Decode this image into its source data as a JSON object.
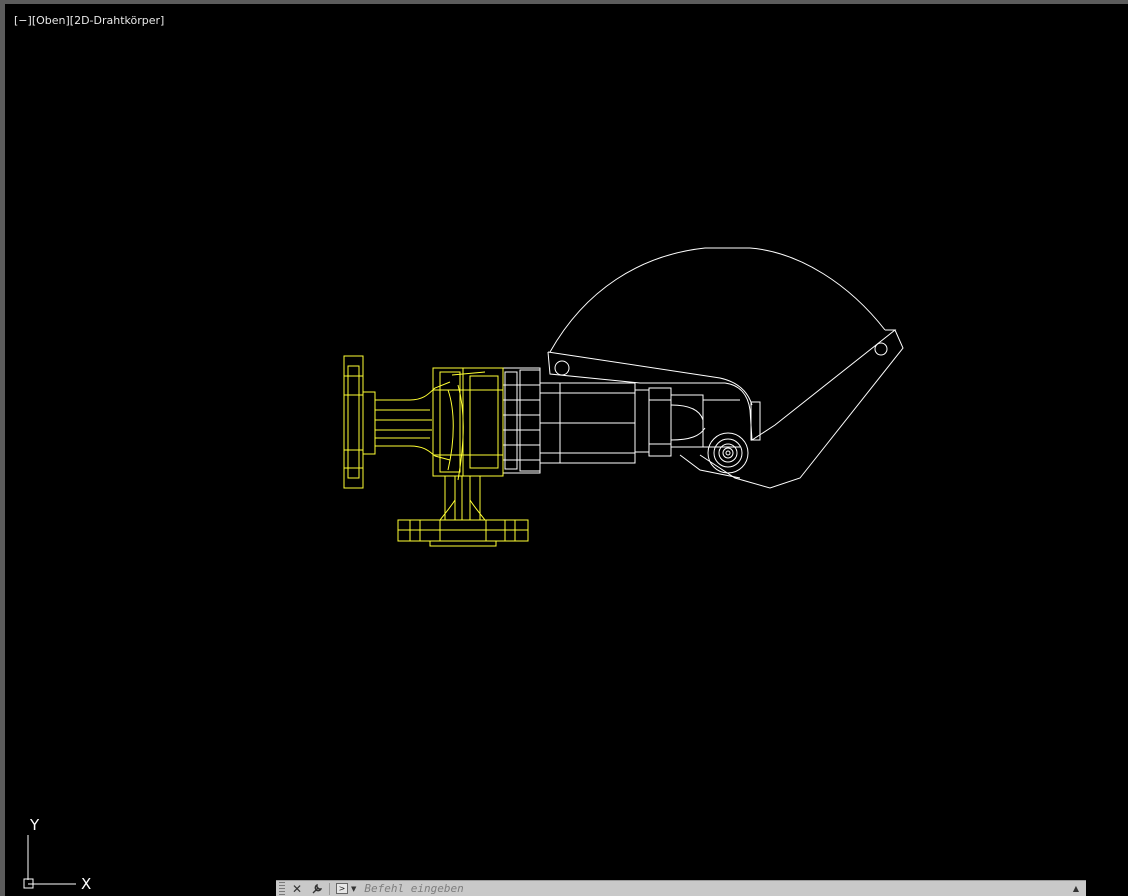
{
  "viewport": {
    "controls": [
      "[−]",
      "[Oben]",
      "[2D-Drahtkörper]"
    ],
    "background": "#000000"
  },
  "drawing": {
    "wire_color": "#ffffff",
    "highlight_color": "#ffff33"
  },
  "ucs": {
    "x_label": "X",
    "y_label": "Y"
  },
  "command_line": {
    "placeholder": "Befehl eingeben",
    "close_icon": "close-icon",
    "customize_icon": "wrench-icon",
    "prompt_icon": "command-prompt-icon",
    "history_icon": "chevron-up-icon"
  }
}
